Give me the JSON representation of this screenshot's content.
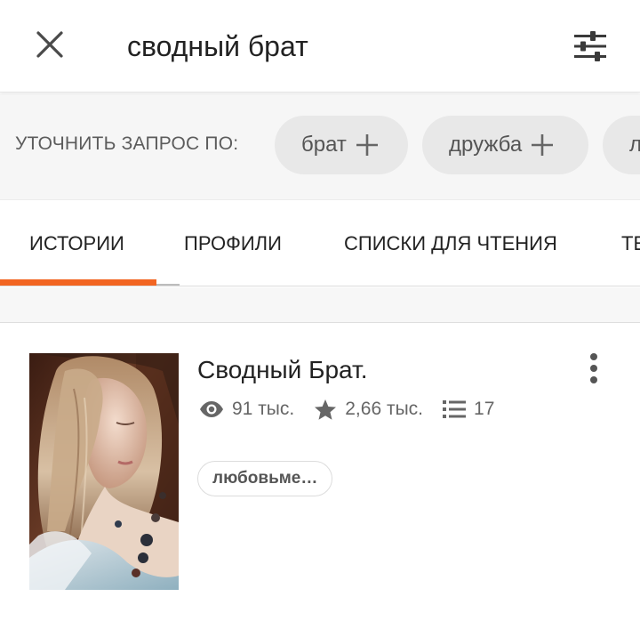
{
  "header": {
    "search_query": "сводный брат",
    "close_icon": "close-icon",
    "filter_icon": "sliders-icon"
  },
  "refine": {
    "label": "УТОЧНИТЬ ЗАПРОС ПО:",
    "chips": [
      {
        "label": "брат"
      },
      {
        "label": "дружба"
      },
      {
        "label": "л"
      }
    ]
  },
  "tabs": [
    {
      "label": "ИСТОРИИ",
      "active": true
    },
    {
      "label": "ПРОФИЛИ"
    },
    {
      "label": "СПИСКИ ДЛЯ ЧТЕНИЯ"
    },
    {
      "label": "ТЕ"
    }
  ],
  "colors": {
    "accent": "#f26522",
    "chip_bg": "#e8e8e8",
    "text_dark": "#222222",
    "text_muted": "#666666"
  },
  "results": [
    {
      "title": "Сводный Брат.",
      "reads": "91 тыс.",
      "votes": "2,66 тыс.",
      "parts": "17",
      "tag": "любовьме…",
      "icons": [
        "eye-icon",
        "star-icon",
        "list-icon",
        "more-vertical-icon"
      ]
    }
  ]
}
